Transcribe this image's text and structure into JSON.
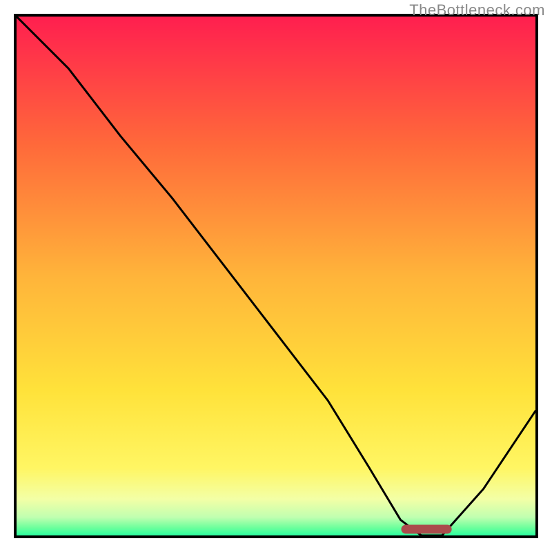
{
  "watermark": "TheBottleneck.com",
  "chart_data": {
    "type": "line",
    "title": "",
    "xlabel": "",
    "ylabel": "",
    "xlim": [
      0,
      100
    ],
    "ylim": [
      0,
      100
    ],
    "grid": false,
    "legend": false,
    "series": [
      {
        "name": "bottleneck-curve",
        "color": "#000000",
        "x": [
          0,
          10,
          20,
          30,
          40,
          50,
          60,
          68,
          74,
          78,
          82,
          90,
          100
        ],
        "y": [
          100,
          90,
          77,
          65,
          52,
          39,
          26,
          13,
          3,
          0,
          0,
          9,
          24
        ]
      }
    ],
    "marker": {
      "name": "optimal-point",
      "x_start": 75,
      "x_end": 83,
      "y": 0,
      "color": "#c76b6b"
    },
    "background_gradient": {
      "stops": [
        {
          "offset": 0.0,
          "color": "#ff1f4f"
        },
        {
          "offset": 0.25,
          "color": "#ff6a3a"
        },
        {
          "offset": 0.5,
          "color": "#ffb43a"
        },
        {
          "offset": 0.72,
          "color": "#ffe23a"
        },
        {
          "offset": 0.87,
          "color": "#fff663"
        },
        {
          "offset": 0.93,
          "color": "#f3ffa6"
        },
        {
          "offset": 0.965,
          "color": "#c0ffb0"
        },
        {
          "offset": 0.985,
          "color": "#6dff9c"
        },
        {
          "offset": 1.0,
          "color": "#2cffa0"
        }
      ]
    }
  }
}
